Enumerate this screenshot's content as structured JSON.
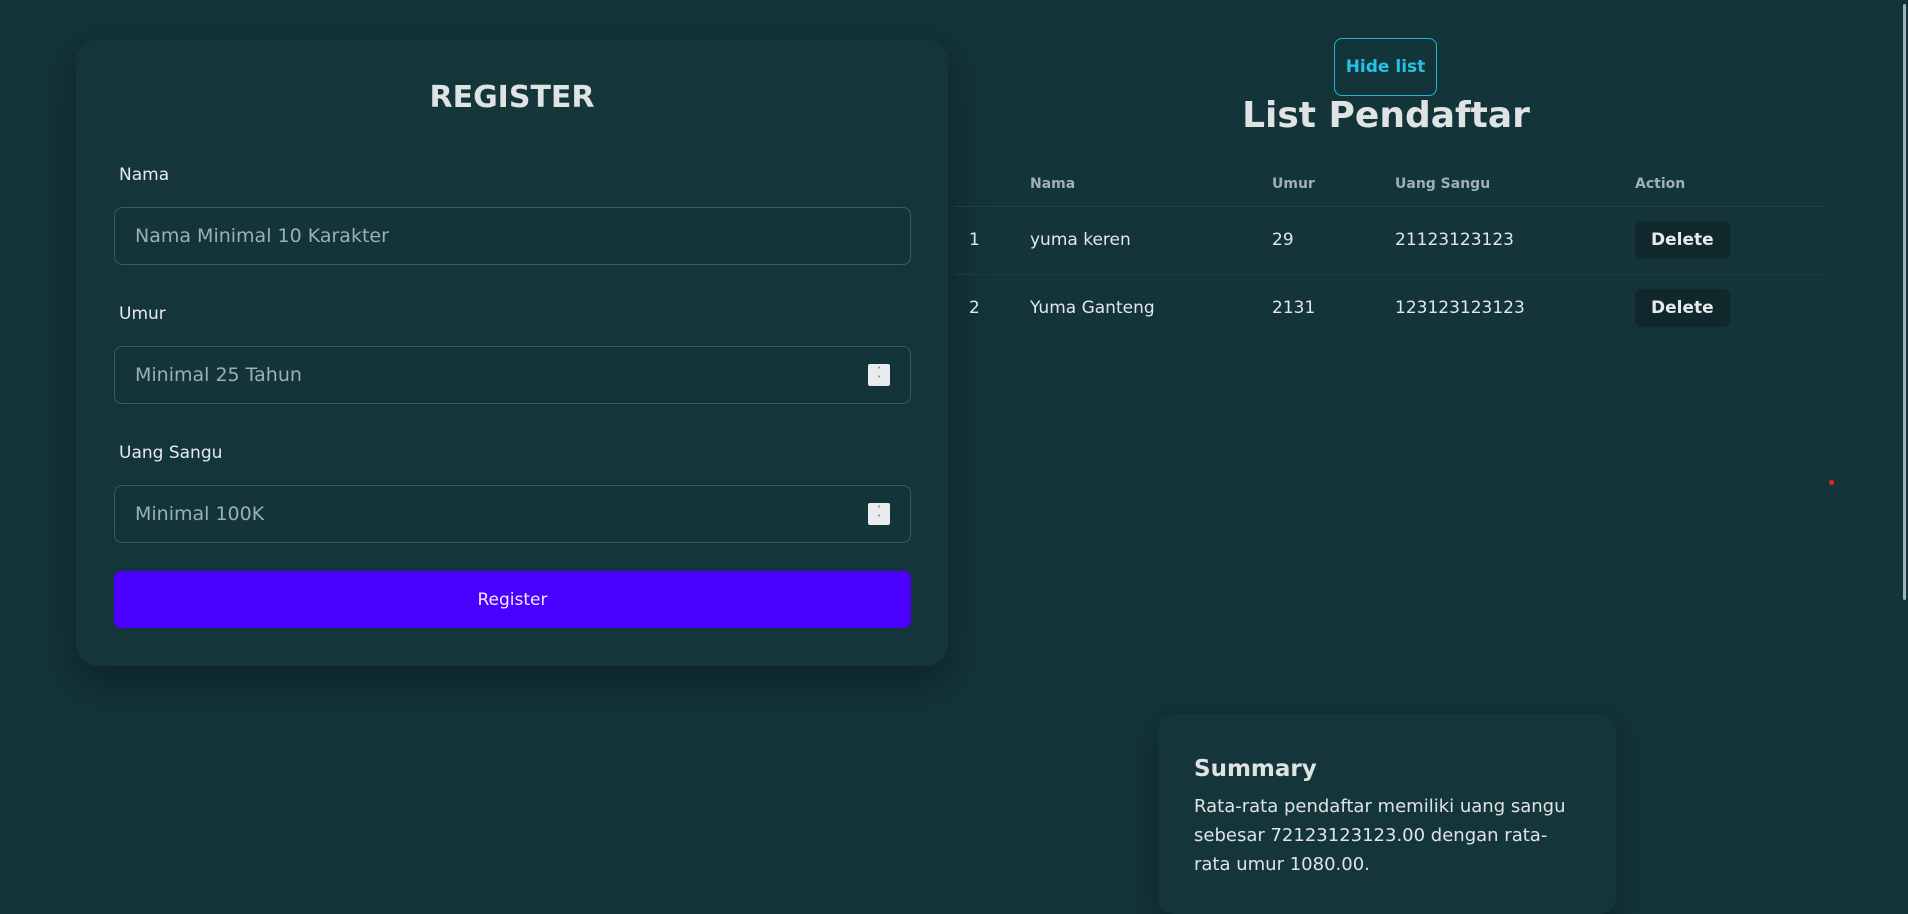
{
  "register": {
    "title": "REGISTER",
    "fields": [
      {
        "label": "Nama",
        "placeholder": "Nama Minimal 10 Karakter",
        "value": ""
      },
      {
        "label": "Umur",
        "placeholder": "Minimal 25 Tahun",
        "value": ""
      },
      {
        "label": "Uang Sangu",
        "placeholder": "Minimal 100K",
        "value": ""
      }
    ],
    "button_label": "Register"
  },
  "list": {
    "toggle_label": "Hide list",
    "title": "List Pendaftar",
    "columns": [
      "",
      "Nama",
      "Umur",
      "Uang Sangu",
      "Action"
    ],
    "rows": [
      {
        "no": "1",
        "nama": "yuma keren",
        "umur": "29",
        "uang": "21123123123",
        "action": "Delete"
      },
      {
        "no": "2",
        "nama": "Yuma Ganteng",
        "umur": "2131",
        "uang": "123123123123",
        "action": "Delete"
      }
    ]
  },
  "summary": {
    "title": "Summary",
    "text": "Rata-rata pendaftar memiliki uang sangu sebesar 72123123123.00 dengan rata-rata umur 1080.00."
  },
  "colors": {
    "background": "#133439",
    "accent_button": "#4a00ff",
    "toggle_border": "#1fb6d9"
  }
}
